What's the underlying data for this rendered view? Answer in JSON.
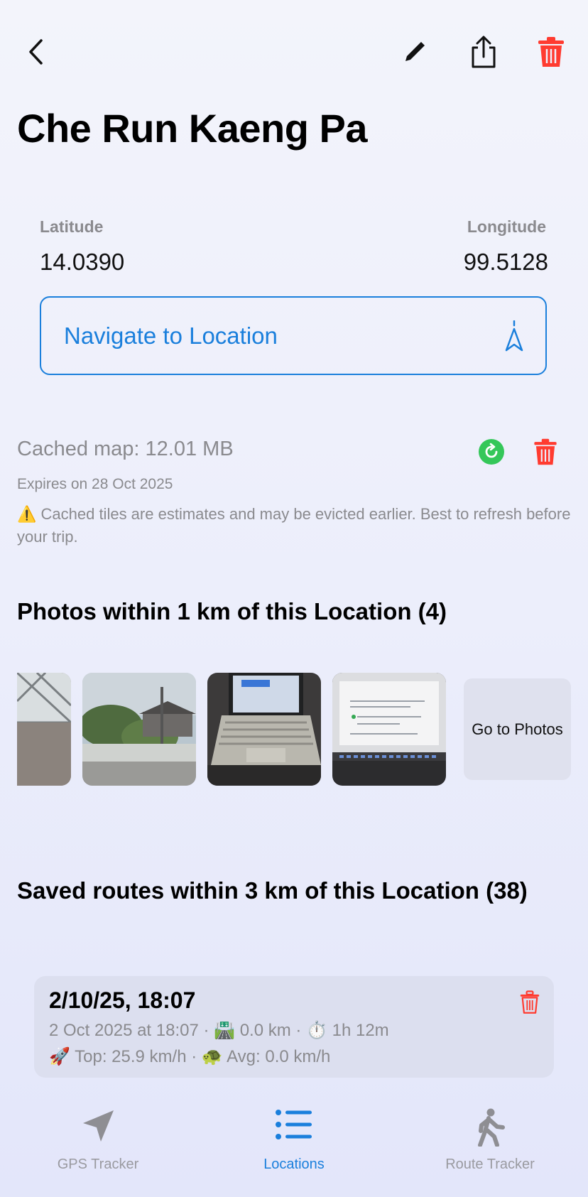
{
  "location": {
    "title": "Che Run Kaeng Pa",
    "latitude_label": "Latitude",
    "latitude_value": "14.0390",
    "longitude_label": "Longitude",
    "longitude_value": "99.5128"
  },
  "navigate": {
    "label": "Navigate to Location"
  },
  "cache": {
    "title": "Cached map: 12.01 MB",
    "expiry": "Expires on 28 Oct 2025",
    "note": "⚠️ Cached tiles are estimates and may be evicted earlier. Best to refresh before your trip."
  },
  "photos": {
    "heading": "Photos within 1 km of this Location (4)",
    "goto_label": "Go to Photos"
  },
  "routes": {
    "heading": "Saved routes within 3 km of this Location (38)",
    "items": [
      {
        "title": "2/10/25, 18:07",
        "line1": "2 Oct 2025 at 18:07 · 🛣️ 0.0 km · ⏱️ 1h 12m",
        "line2": "🚀 Top: 25.9 km/h · 🐢 Avg: 0.0 km/h"
      }
    ]
  },
  "tabs": [
    {
      "label": "GPS Tracker",
      "icon": "navigation-arrow-icon"
    },
    {
      "label": "Locations",
      "icon": "list-icon",
      "active": true
    },
    {
      "label": "Route Tracker",
      "icon": "walking-person-icon"
    }
  ],
  "colors": {
    "accent": "#1a7fdc",
    "danger": "#ff3b30",
    "success": "#34c759"
  }
}
